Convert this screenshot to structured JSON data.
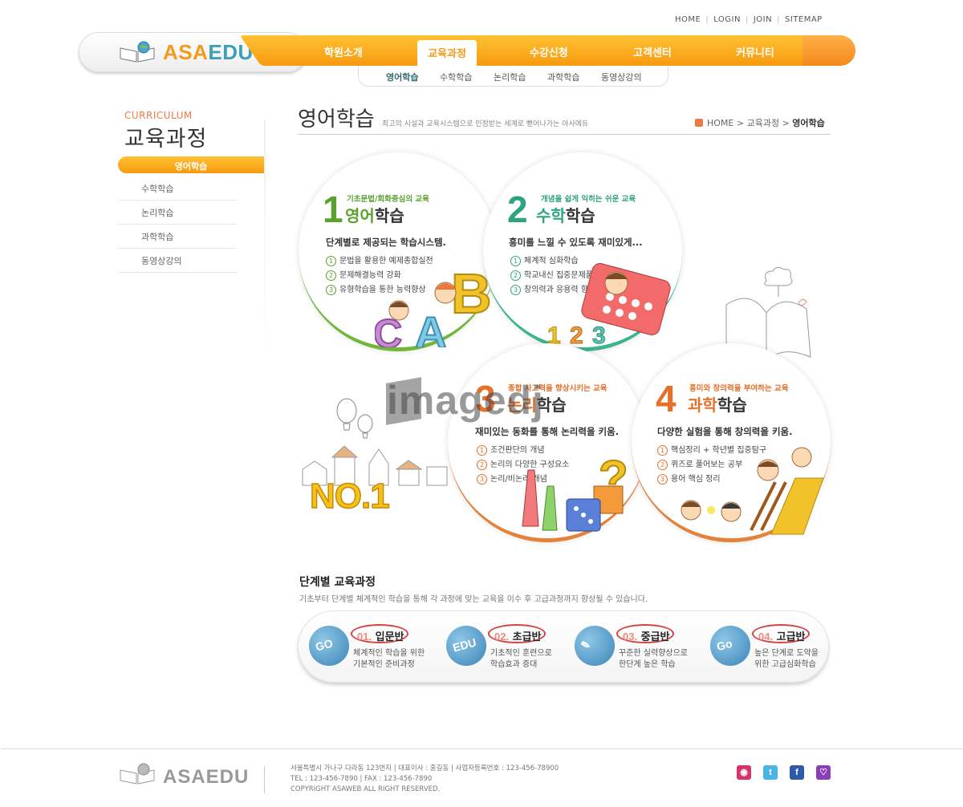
{
  "util_links": [
    "HOME",
    "LOGIN",
    "JOIN",
    "SITEMAP"
  ],
  "logo": {
    "part1": "ASA",
    "part2": "EDU"
  },
  "nav": {
    "items": [
      "학원소개",
      "교육과정",
      "수강신청",
      "고객센터",
      "커뮤니티"
    ],
    "active": "교육과정"
  },
  "subnav": {
    "items": [
      "영어학습",
      "수학학습",
      "논리학습",
      "과학학습",
      "동영상강의"
    ],
    "active": "영어학습"
  },
  "sidebar": {
    "eyebrow": "CURRICULUM",
    "title": "교육과정",
    "active": "영어학습",
    "items": [
      "수학학습",
      "논리학습",
      "과학학습",
      "동영상강의"
    ]
  },
  "page": {
    "title": "영어학습",
    "subtitle": "최고의 시설과 교육시스템으로 인정받는 세계로 뻗어나가는 아사에듀",
    "breadcrumb": {
      "home": "HOME",
      "section": "교육과정",
      "current": "영어학습"
    }
  },
  "courses": [
    {
      "num": "1",
      "tag": "기초문법/회화중심의 교육",
      "title_hl": "영어",
      "title_rest": "학습",
      "lead": "단계별로 제공되는 학습시스템.",
      "points": [
        "문법을 활용한 예제종합실전",
        "문제해결능력 강화",
        "유형학습을 통한 능력향상"
      ],
      "color": "#5aa22c"
    },
    {
      "num": "2",
      "tag": "개념을 쉽게 익히는 쉬운 교육",
      "title_hl": "수학",
      "title_rest": "학습",
      "lead": "흥미를 느낄 수 있도록 재미있게...",
      "points": [
        "체계적 심화학습",
        "학교내신 집중문제풀이",
        "창의력과 응용력 향상"
      ],
      "color": "#2ea37f"
    },
    {
      "num": "3",
      "tag": "종합 사고력을 향상시키는 교육",
      "title_hl": "논리",
      "title_rest": "학습",
      "lead": "재미있는 동화를 통해 논리력을 키움.",
      "points": [
        "조건판단의 개념",
        "논리의 다양한 구성요소",
        "논리/비논리 개념"
      ],
      "color": "#e4702a"
    },
    {
      "num": "4",
      "tag": "흥미와 창의력을 부여하는 교육",
      "title_hl": "과학",
      "title_rest": "학습",
      "lead": "다양한 실험을 통해 창의력을 키움.",
      "points": [
        "핵심정리 + 학년별 집중탐구",
        "퀴즈로 풀어보는 공부",
        "용어 핵심 정리"
      ],
      "color": "#e4702a"
    }
  ],
  "watermark": "imagedj",
  "badge": "NO.1",
  "stages": {
    "title": "단계별 교육과정",
    "subtitle": "기초부터 단계별 체계적인 학습을 통해 각 과정에 맞는 교육을 이수 후 고급과정까지 향상될 수 있습니다.",
    "items": [
      {
        "num": "01.",
        "name": "입문반",
        "icon_text": "GO",
        "desc1": "체계적인 학습을 위한",
        "desc2": "기본적인 준비과정"
      },
      {
        "num": "02.",
        "name": "초급반",
        "icon_text": "EDU",
        "desc1": "기초적인 훈련으로",
        "desc2": "학습효과 증대"
      },
      {
        "num": "03.",
        "name": "중급반",
        "icon_text": "✎",
        "desc1": "꾸준한 실력향상으로",
        "desc2": "한단계 높은 학습"
      },
      {
        "num": "04.",
        "name": "고급반",
        "icon_text": "Go",
        "desc1": "높은 단계로 도약을",
        "desc2": "위한 고급심화학습"
      }
    ]
  },
  "footer": {
    "logo": "ASAEDU",
    "line1": "서울특별시 가나구 다라동 123번지  |  대표이사 : 홍길동  |  사업자등록번호 : 123-456-78900",
    "line2": "TEL : 123-456-7890  |  FAX : 123-456-7890",
    "line3": "COPYRIGHT ASAWEB ALL RIGHT RESERVED."
  },
  "colors": {
    "accent": "#f79a0f",
    "accent_light": "#ffc233",
    "logo_blue": "#3d9fb8"
  }
}
